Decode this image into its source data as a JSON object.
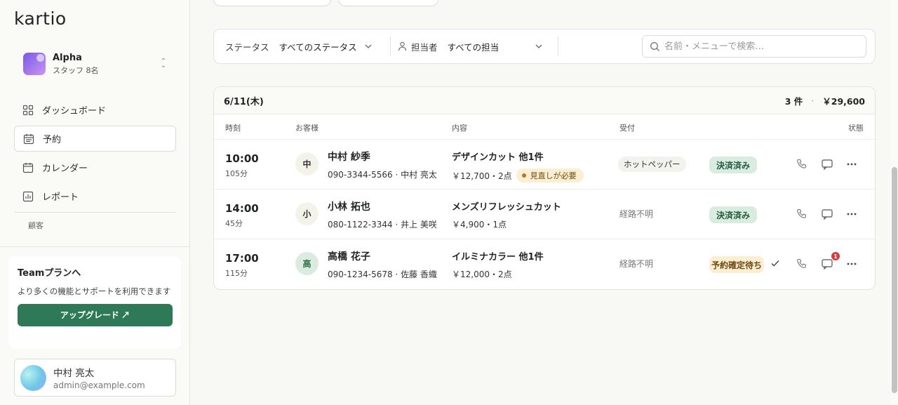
{
  "app": {
    "logo": "kartio"
  },
  "workspace": {
    "name": "Alpha",
    "sub": "スタッフ 8名"
  },
  "nav": [
    {
      "label": "ダッシュボード",
      "icon": "grid-icon"
    },
    {
      "label": "予約",
      "icon": "calendar-icon",
      "active": true
    },
    {
      "label": "カレンダー",
      "icon": "calendar-icon"
    },
    {
      "label": "レポート",
      "icon": "chart-icon"
    }
  ],
  "nav_section": "顧客",
  "upgrade": {
    "title": "Teamプランへ",
    "desc": "より多くの機能とサポートを利用できます",
    "button": "アップグレード ↗"
  },
  "user": {
    "name": "中村 亮太",
    "email": "admin@example.com"
  },
  "filters": {
    "status_label": "ステータス",
    "status_value": "すべてのステータス",
    "staff_label": "担当者",
    "staff_value": "すべての担当",
    "search_placeholder": "名前・メニューで検索…"
  },
  "day": {
    "date": "6/11(木)",
    "count": "3 件",
    "dot": "·",
    "total": "￥29,600"
  },
  "columns": {
    "time": "時刻",
    "customer": "お客様",
    "content": "内容",
    "source": "受付",
    "status": "状態"
  },
  "rows": [
    {
      "time": "10:00",
      "duration": "105分",
      "initial": "中",
      "name": "中村 紗季",
      "phone_staff": "090-3344-5566 · 中村 亮太",
      "service": "デザインカット 他1件",
      "price": "￥12,700・2点",
      "warning": "見直しが必要",
      "source": "ホットペッパー",
      "status": "決済済み"
    },
    {
      "time": "14:00",
      "duration": "45分",
      "initial": "小",
      "name": "小林 拓也",
      "phone_staff": "080-1122-3344 · 井上 美咲",
      "service": "メンズリフレッシュカット",
      "price": "￥4,900・1点",
      "source": "経路不明",
      "status": "決済済み"
    },
    {
      "time": "17:00",
      "duration": "115分",
      "initial": "高",
      "name": "高橋 花子",
      "phone_staff": "090-1234-5678 · 佐藤 香織",
      "service": "イルミナカラー 他1件",
      "price": "￥12,000・2点",
      "source": "経路不明",
      "status": "予約確定待ち",
      "message_badge": "1"
    }
  ],
  "colors": {
    "accent": "#2f7a56",
    "paid_bg": "#d9ece0",
    "pending_bg": "#fbeed2",
    "badge": "#d93b3b"
  }
}
